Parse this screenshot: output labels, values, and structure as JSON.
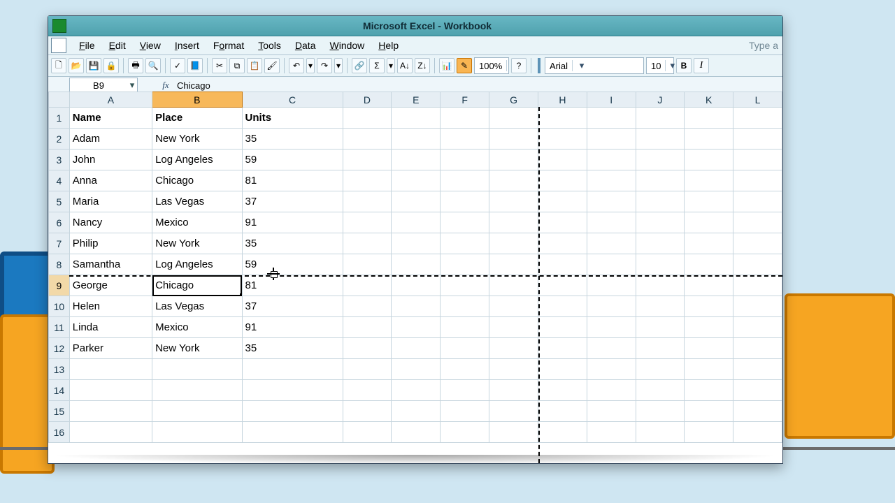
{
  "window": {
    "title": "Microsoft Excel - Workbook"
  },
  "menu": {
    "file": "File",
    "edit": "Edit",
    "view": "View",
    "insert": "Insert",
    "format": "Format",
    "tools": "Tools",
    "data": "Data",
    "window": "Window",
    "help": "Help",
    "type_a": "Type a"
  },
  "toolbar": {
    "zoom": "100%",
    "font": "Arial",
    "size": "10",
    "bold": "B",
    "italic": "I"
  },
  "formula_bar": {
    "name_box": "B9",
    "fx": "fx",
    "value": "Chicago"
  },
  "columns": [
    "A",
    "B",
    "C",
    "D",
    "E",
    "F",
    "G",
    "H",
    "I",
    "J",
    "K",
    "L"
  ],
  "selected_column": "B",
  "selected_row": 9,
  "active_cell": "B9",
  "page_break_after_row": 8,
  "page_break_after_col": "G",
  "rows": [
    {
      "n": 1,
      "A": "Name",
      "B": "Place",
      "C": "Units"
    },
    {
      "n": 2,
      "A": "Adam",
      "B": "New York",
      "C": "35"
    },
    {
      "n": 3,
      "A": "John",
      "B": "Log Angeles",
      "C": "59"
    },
    {
      "n": 4,
      "A": "Anna",
      "B": "Chicago",
      "C": "81"
    },
    {
      "n": 5,
      "A": "Maria",
      "B": "Las Vegas",
      "C": "37"
    },
    {
      "n": 6,
      "A": "Nancy",
      "B": "Mexico",
      "C": "91"
    },
    {
      "n": 7,
      "A": "Philip",
      "B": "New York",
      "C": "35"
    },
    {
      "n": 8,
      "A": "Samantha",
      "B": "Log Angeles",
      "C": "59"
    },
    {
      "n": 9,
      "A": "George",
      "B": "Chicago",
      "C": "81"
    },
    {
      "n": 10,
      "A": "Helen",
      "B": "Las Vegas",
      "C": "37"
    },
    {
      "n": 11,
      "A": "Linda",
      "B": "Mexico",
      "C": "91"
    },
    {
      "n": 12,
      "A": "Parker",
      "B": "New York",
      "C": "35"
    },
    {
      "n": 13
    },
    {
      "n": 14
    },
    {
      "n": 15
    },
    {
      "n": 16
    }
  ],
  "icons": {
    "new": "🗋",
    "open": "📂",
    "save": "💾",
    "perm": "🔒",
    "print": "🖶",
    "preview": "🔍",
    "spell": "✓",
    "research": "📘",
    "cut": "✂",
    "copy": "⧉",
    "paste": "📋",
    "fmtpaint": "🖌",
    "undo": "↶",
    "redo": "↷",
    "link": "🔗",
    "autosum": "Σ",
    "sortasc": "A↓",
    "sortdesc": "Z↓",
    "chart": "📊",
    "drawing": "✎",
    "help": "?"
  }
}
